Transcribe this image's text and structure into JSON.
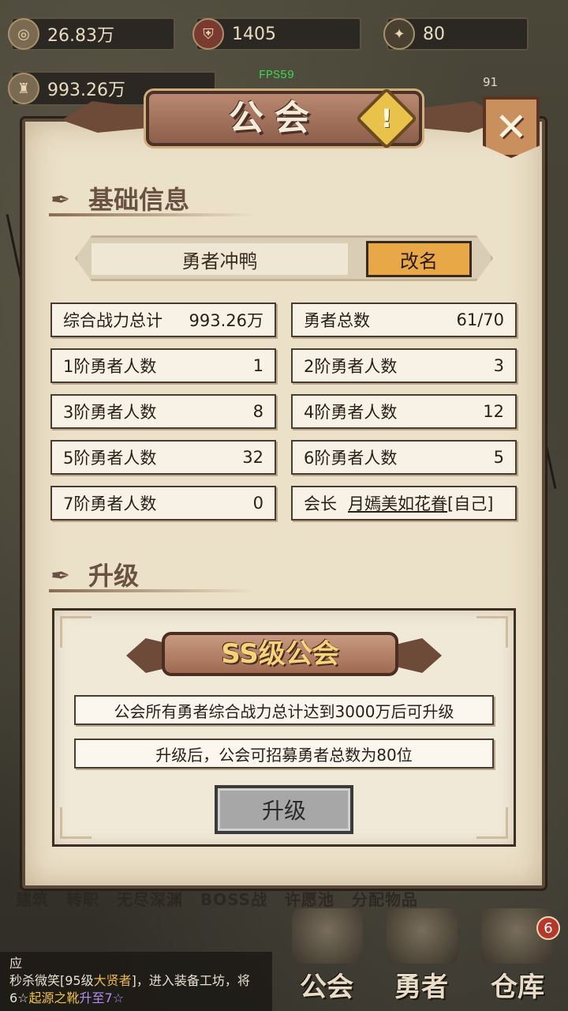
{
  "hud": {
    "gold": "26.83万",
    "gems": "1405",
    "energy": "80",
    "power": "993.26万",
    "side_number": "91",
    "fps": "FPS59"
  },
  "dialog": {
    "title": "公会",
    "help": "!",
    "close": "✕"
  },
  "basic_info": {
    "section_title": "基础信息",
    "guild_name": "勇者冲鸭",
    "rename_label": "改名",
    "stats": [
      {
        "label": "综合战力总计",
        "value": "993.26万"
      },
      {
        "label": "勇者总数",
        "value": "61/70"
      },
      {
        "label": "1阶勇者人数",
        "value": "1"
      },
      {
        "label": "2阶勇者人数",
        "value": "3"
      },
      {
        "label": "3阶勇者人数",
        "value": "8"
      },
      {
        "label": "4阶勇者人数",
        "value": "12"
      },
      {
        "label": "5阶勇者人数",
        "value": "32"
      },
      {
        "label": "6阶勇者人数",
        "value": "5"
      },
      {
        "label": "7阶勇者人数",
        "value": "0"
      }
    ],
    "leader": {
      "label": "会长",
      "name": "月嫣美如花眷",
      "suffix": "[自己]"
    }
  },
  "upgrade": {
    "section_title": "升级",
    "rank_title": "SS级公会",
    "condition": "公会所有勇者综合战力总计达到3000万后可升级",
    "benefit": "升级后，公会可招募勇者总数为80位",
    "button_label": "升级"
  },
  "bottom": {
    "bg_tabs": [
      "建筑",
      "转职",
      "无尽深渊",
      "BOSS战",
      "许愿池",
      "分配物品"
    ],
    "ticker": {
      "line0": "应",
      "prefix": "秒杀微笑[95级",
      "class_name": "大贤者",
      "mid": "]，进入装备工坊，将6☆",
      "item": "起源之靴",
      "up": "升至7☆"
    },
    "nav": [
      {
        "label": "公会"
      },
      {
        "label": "勇者"
      },
      {
        "label": "仓库",
        "badge": "6"
      }
    ]
  }
}
